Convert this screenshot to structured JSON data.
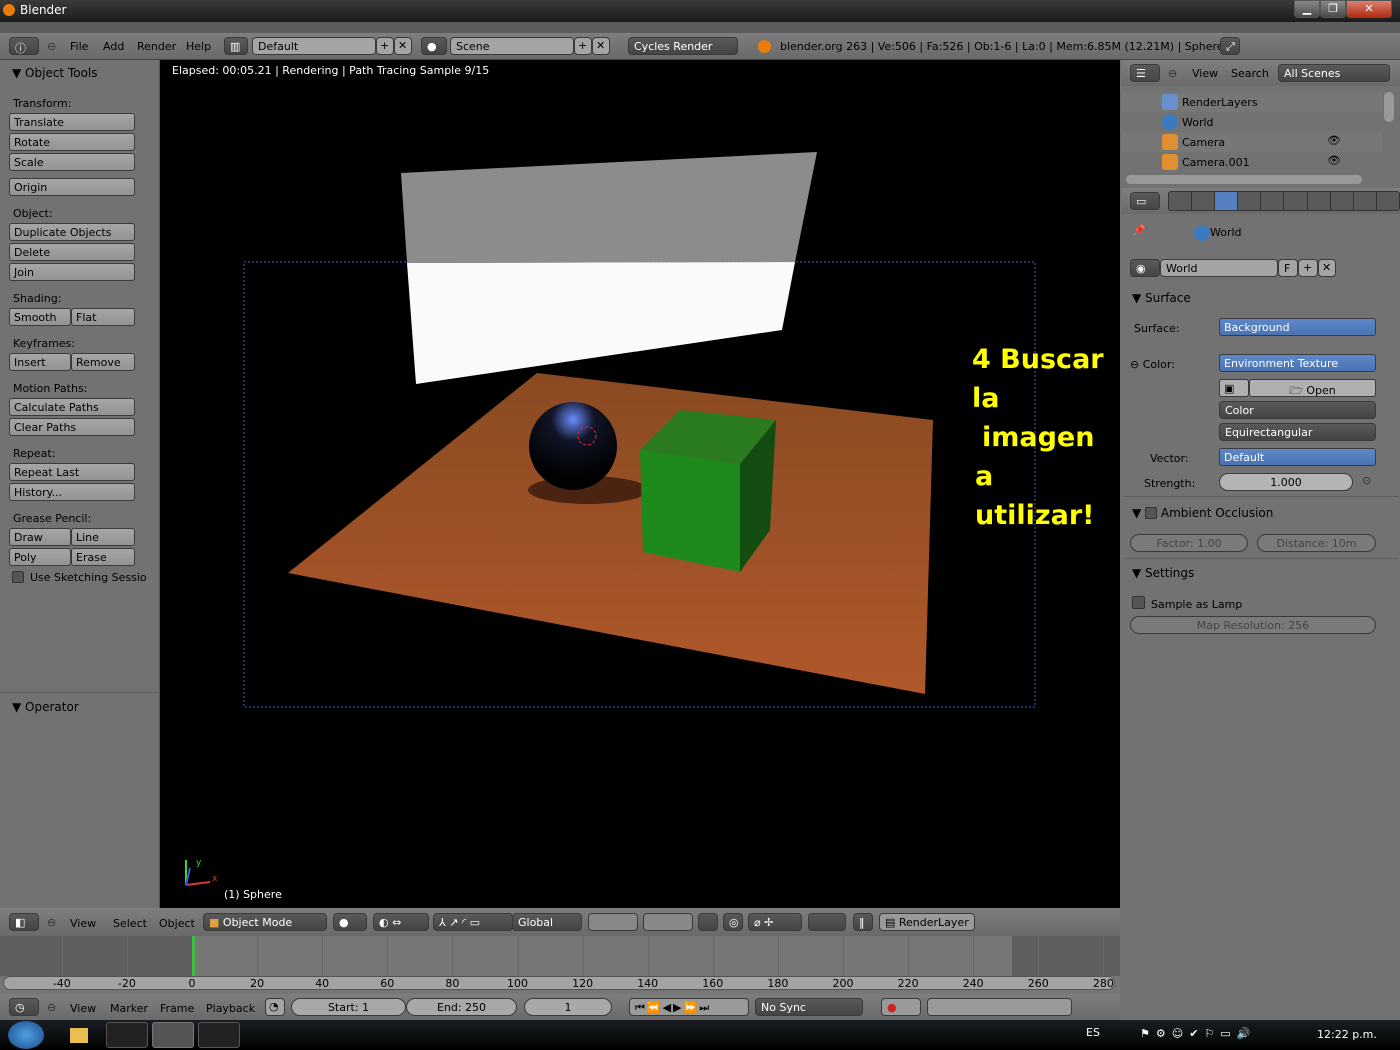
{
  "window": {
    "title": "Blender",
    "minimize": "▁",
    "maximize": "❐",
    "close": "✕"
  },
  "info": {
    "menus": [
      "File",
      "Add",
      "Render",
      "Help"
    ],
    "layout": "Default",
    "scene": "Scene",
    "engine": "Cycles Render",
    "stats": "blender.org 263 | Ve:506 | Fa:526 | Ob:1-6 | La:0 | Mem:6.85M (12.21M) | Sphere"
  },
  "shelf": {
    "title": "Object Tools",
    "transform_label": "Transform:",
    "translate": "Translate",
    "rotate": "Rotate",
    "scale": "Scale",
    "origin": "Origin",
    "object_label": "Object:",
    "duplicate": "Duplicate Objects",
    "delete": "Delete",
    "join": "Join",
    "shading_label": "Shading:",
    "smooth": "Smooth",
    "flat": "Flat",
    "keyframes_label": "Keyframes:",
    "insert": "Insert",
    "remove": "Remove",
    "motion_label": "Motion Paths:",
    "calc_paths": "Calculate Paths",
    "clear_paths": "Clear Paths",
    "repeat_label": "Repeat:",
    "repeat_last": "Repeat Last",
    "history": "History...",
    "grease_label": "Grease Pencil:",
    "draw": "Draw",
    "line": "Line",
    "poly": "Poly",
    "erase": "Erase",
    "sketching": "Use Sketching Sessio",
    "operator": "Operator"
  },
  "viewport": {
    "status": "Elapsed: 00:05.21 | Rendering | Path Tracing Sample 9/15",
    "object_label": "(1) Sphere",
    "axis_x": "x",
    "axis_y": "y"
  },
  "annotation": {
    "line1": "4 Buscar la",
    "line2": "imagen",
    "line3": "a utilizar!",
    "color": "#ffff00"
  },
  "outliner": {
    "view": "View",
    "search": "Search",
    "filter": "All Scenes",
    "items": [
      "RenderLayers",
      "World",
      "Camera",
      "Camera.001"
    ]
  },
  "properties": {
    "breadcrumb": "World",
    "world_name": "World",
    "fake_user": "F",
    "surface_section": "Surface",
    "surface_label": "Surface:",
    "surface_value": "Background",
    "color_label": "Color:",
    "color_value": "Environment Texture",
    "open": "Open",
    "color_mode": "Color",
    "projection": "Equirectangular",
    "vector_label": "Vector:",
    "vector_value": "Default",
    "strength_label": "Strength:",
    "strength_value": "1.000",
    "ao_section": "Ambient Occlusion",
    "ao_factor": "Factor: 1.00",
    "ao_distance": "Distance: 10m",
    "settings_section": "Settings",
    "sample_as_lamp": "Sample as Lamp",
    "map_resolution": "Map Resolution: 256"
  },
  "view3d_header": {
    "menus": [
      "View",
      "Select",
      "Object"
    ],
    "mode": "Object Mode",
    "orientation": "Global",
    "render_layer": "RenderLayer"
  },
  "timeline": {
    "ticks": [
      "-40",
      "-20",
      "0",
      "20",
      "40",
      "60",
      "80",
      "100",
      "120",
      "140",
      "160",
      "180",
      "200",
      "220",
      "240",
      "260",
      "280"
    ],
    "current_frame": "1",
    "start": "Start: 1",
    "end": "End: 250",
    "menus": [
      "View",
      "Marker",
      "Frame",
      "Playback"
    ],
    "sync": "No Sync"
  },
  "taskbar": {
    "language": "ES",
    "clock": "12:22 p.m."
  }
}
